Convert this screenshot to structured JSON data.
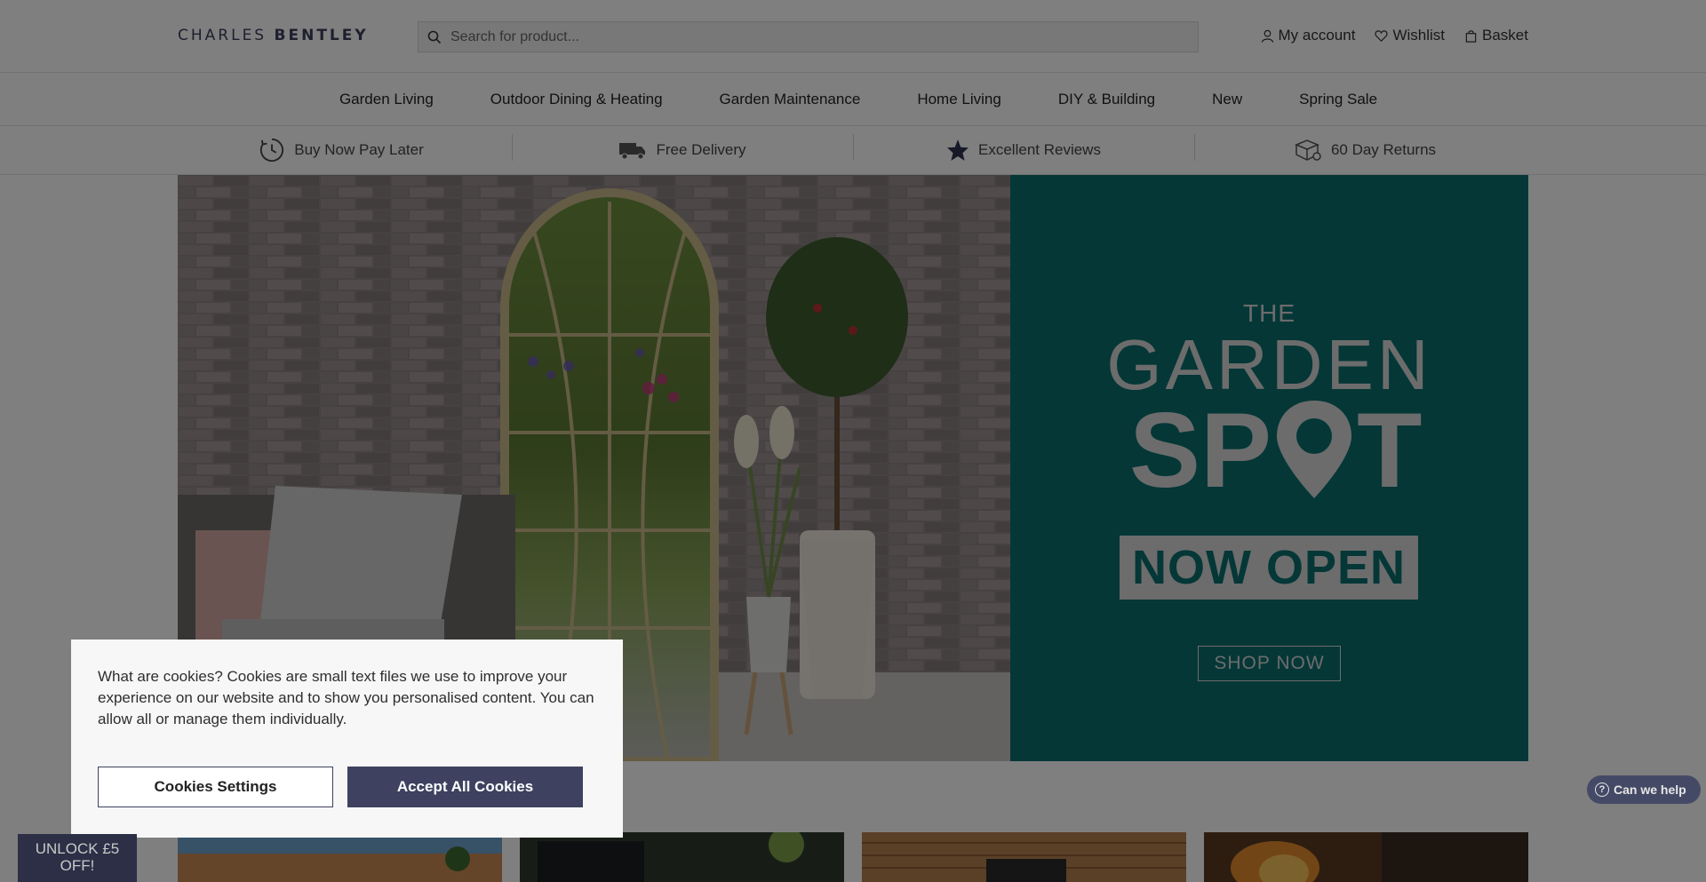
{
  "header": {
    "logo_light": "CHARLES",
    "logo_bold": "BENTLEY",
    "search_placeholder": "Search for product...",
    "links": {
      "account": "My account",
      "wishlist": "Wishlist",
      "basket": "Basket"
    }
  },
  "nav": {
    "items": [
      "Garden Living",
      "Outdoor Dining & Heating",
      "Garden Maintenance",
      "Home Living",
      "DIY & Building",
      "New",
      "Spring Sale"
    ]
  },
  "benefits": [
    {
      "label": "Buy Now Pay Later",
      "icon": "clock-icon"
    },
    {
      "label": "Free Delivery",
      "icon": "truck-icon"
    },
    {
      "label": "Excellent Reviews",
      "icon": "star-icon"
    },
    {
      "label": "60 Day Returns",
      "icon": "box-icon"
    }
  ],
  "hero": {
    "the": "THE",
    "garden": "GARDEN",
    "spot_a": "SP",
    "spot_b": "T",
    "now_open": "NOW OPEN",
    "shop_now": "SHOP NOW"
  },
  "cookie": {
    "text": "What are cookies? Cookies are small text files we use to improve your experience on our website and to show you personalised content. You can allow all or manage them individually.",
    "settings_label": "Cookies Settings",
    "accept_label": "Accept All Cookies"
  },
  "unlock": {
    "line1": "UNLOCK £5",
    "line2": "OFF!"
  },
  "help": {
    "label": "Can we help",
    "icon_glyph": "?"
  },
  "colors": {
    "brand_navy": "#3e4260",
    "teal": "#0b6e6e",
    "overlay": "rgba(0,0,0,0.5)"
  }
}
